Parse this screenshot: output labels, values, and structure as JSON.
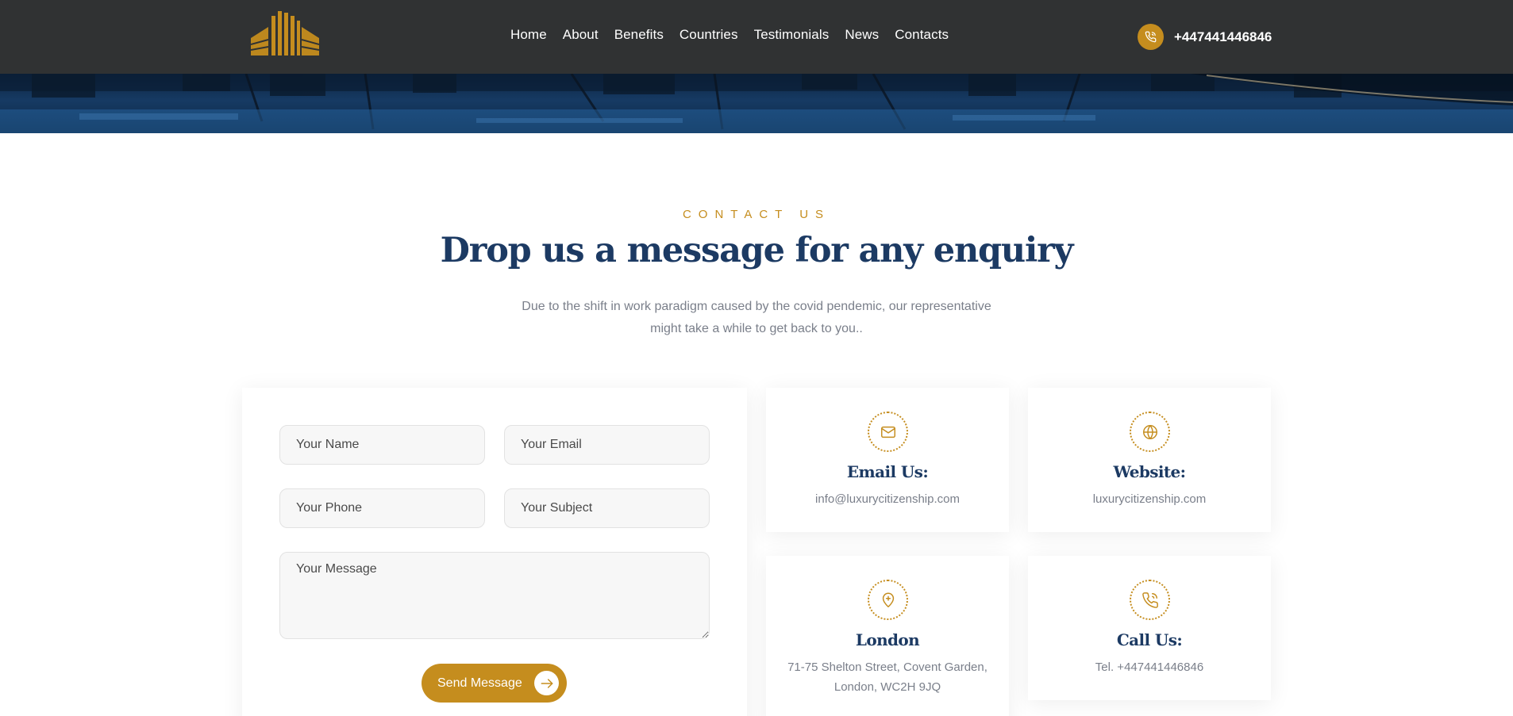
{
  "header": {
    "nav": [
      "Home",
      "About",
      "Benefits",
      "Countries",
      "Testimonials",
      "News",
      "Contacts"
    ],
    "phone": "+447441446846"
  },
  "section": {
    "eyebrow": "CONTACT US",
    "title": "Drop us a message for any enquiry",
    "subtitle": "Due to the shift in work paradigm caused by the covid pendemic, our representative might take a while to get back to you.."
  },
  "form": {
    "name_placeholder": "Your Name",
    "email_placeholder": "Your Email",
    "phone_placeholder": "Your Phone",
    "subject_placeholder": "Your Subject",
    "message_placeholder": "Your Message",
    "submit_label": "Send Message"
  },
  "cards": {
    "email": {
      "title": "Email Us:",
      "text": "info@luxurycitizenship.com",
      "icon": "mail-icon"
    },
    "website": {
      "title": "Website:",
      "text": "luxurycitizenship.com",
      "icon": "globe-icon"
    },
    "london": {
      "title": "London",
      "text": "71-75 Shelton Street, Covent Garden, London, WC2H 9JQ",
      "icon": "location-pin-icon"
    },
    "call": {
      "title": "Call Us:",
      "text": "Tel. +447441446846",
      "icon": "phone-icon"
    }
  },
  "colors": {
    "accent": "#c58d1e",
    "heading": "#1c3a63",
    "header_bg": "#303233",
    "muted_text": "#7a7f8a"
  }
}
